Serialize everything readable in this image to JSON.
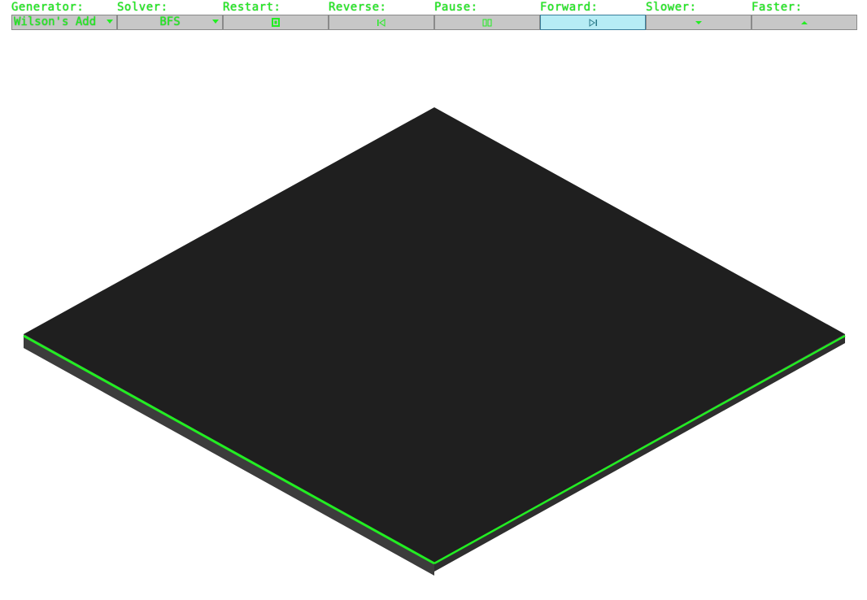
{
  "toolbar": {
    "generator": {
      "label": "Generator:",
      "value": "Wilson's Add"
    },
    "solver": {
      "label": "Solver:",
      "value": "BFS"
    },
    "restart": {
      "label": "Restart:",
      "icon": "restart-icon"
    },
    "reverse": {
      "label": "Reverse:",
      "icon": "step-reverse-icon"
    },
    "pause": {
      "label": "Pause:",
      "icon": "pause-icon"
    },
    "forward": {
      "label": "Forward:",
      "icon": "step-forward-icon"
    },
    "slower": {
      "label": "Slower:",
      "icon": "triangle-down-icon"
    },
    "faster": {
      "label": "Faster:",
      "icon": "triangle-up-icon"
    }
  },
  "colors": {
    "accent_green": "#22ee22",
    "control_bg": "#c7c7c7",
    "active_bg": "#b6ecf5",
    "floor_top": "#1f1f1f",
    "floor_side": "#3c3c3c",
    "floor_edge": "#22ee22"
  }
}
